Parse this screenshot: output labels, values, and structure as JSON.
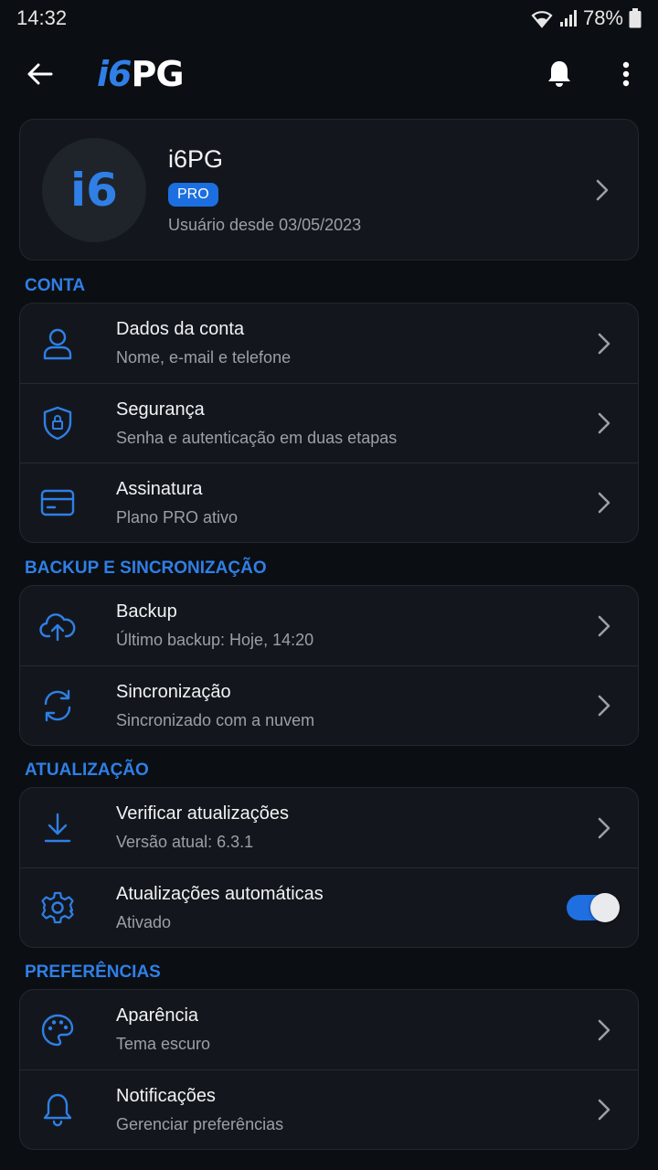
{
  "status_bar": {
    "time": "14:32",
    "battery": "78%"
  },
  "app_bar": {
    "brand_part1": "i6",
    "brand_part2": "PG"
  },
  "profile": {
    "avatar_text": "i6",
    "name": "i6PG",
    "badge": "PRO",
    "since": "Usuário desde 03/05/2023"
  },
  "sections": {
    "conta": {
      "title": "CONTA",
      "items": [
        {
          "title": "Dados da conta",
          "subtitle": "Nome, e-mail e telefone",
          "icon": "person-icon"
        },
        {
          "title": "Segurança",
          "subtitle": "Senha e autenticação em duas etapas",
          "icon": "shield-lock-icon"
        },
        {
          "title": "Assinatura",
          "subtitle": "Plano PRO ativo",
          "icon": "credit-card-icon"
        }
      ]
    },
    "backup": {
      "title": "BACKUP E SINCRONIZAÇÃO",
      "items": [
        {
          "title": "Backup",
          "subtitle": "Último backup: Hoje, 14:20",
          "icon": "cloud-upload-icon"
        },
        {
          "title": "Sincronização",
          "subtitle": "Sincronizado com a nuvem",
          "icon": "sync-icon"
        }
      ]
    },
    "atualizacao": {
      "title": "ATUALIZAÇÃO",
      "items": [
        {
          "title": "Verificar atualizações",
          "subtitle": "Versão atual: 6.3.1",
          "icon": "download-icon"
        },
        {
          "title": "Atualizações automáticas",
          "subtitle": "Ativado",
          "icon": "gear-icon",
          "toggle_on": true
        }
      ]
    },
    "preferencias": {
      "title": "PREFERÊNCIAS",
      "items": [
        {
          "title": "Aparência",
          "subtitle": "Tema escuro",
          "icon": "palette-icon"
        },
        {
          "title": "Notificações",
          "subtitle": "Gerenciar preferências",
          "icon": "bell-icon"
        }
      ]
    }
  },
  "colors": {
    "accent": "#2f7fe6",
    "background": "#0b0e12",
    "card": "#13171d"
  }
}
